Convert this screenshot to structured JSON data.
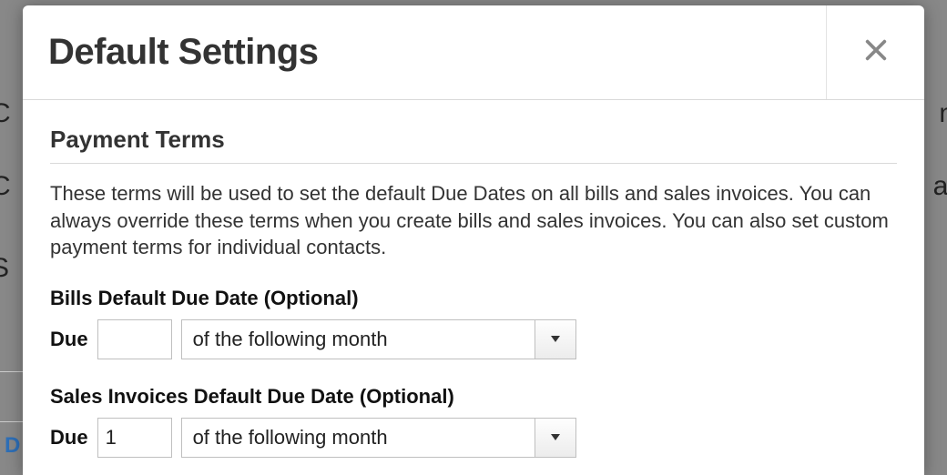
{
  "modal": {
    "title": "Default Settings"
  },
  "section": {
    "heading": "Payment Terms",
    "description": "These terms will be used to set the default Due Dates on all bills and sales invoices. You can always override these terms when you create bills and sales invoices. You can also set custom payment terms for individual contacts."
  },
  "bills": {
    "label": "Bills Default Due Date (Optional)",
    "prefix": "Due",
    "value": "",
    "option": "of the following month"
  },
  "sales": {
    "label": "Sales Invoices Default Due Date (Optional)",
    "prefix": "Due",
    "value": "1",
    "option": "of the following month"
  },
  "bg": {
    "c1": "C",
    "c2": "C",
    "s1": "S",
    "r1": "n",
    "r2": "al",
    "link": "D"
  }
}
